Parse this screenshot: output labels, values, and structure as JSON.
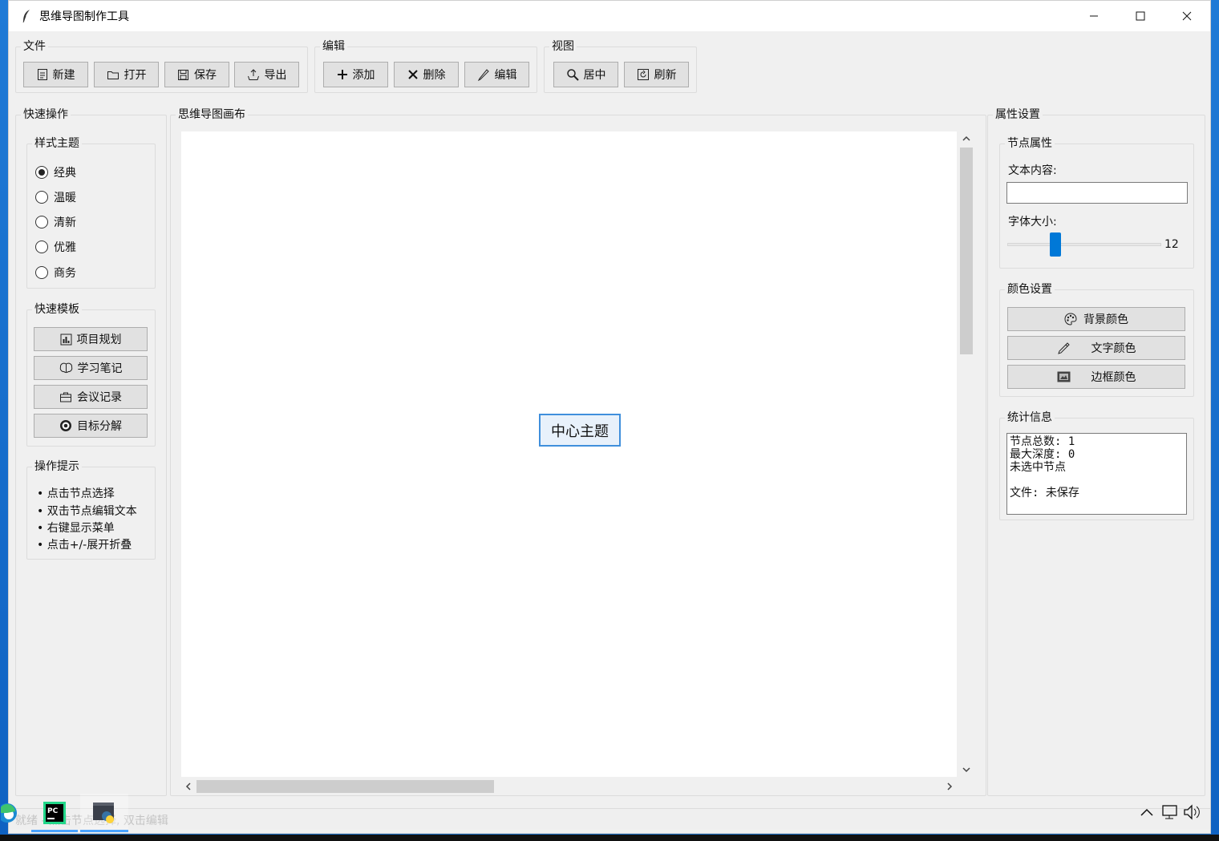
{
  "window": {
    "title": "思维导图制作工具"
  },
  "toolbar": {
    "file": {
      "label": "文件",
      "new": "新建",
      "open": "打开",
      "save": "保存",
      "export": "导出"
    },
    "edit": {
      "label": "编辑",
      "add": "添加",
      "delete": "删除",
      "edit": "编辑"
    },
    "view": {
      "label": "视图",
      "center": "居中",
      "refresh": "刷新"
    }
  },
  "quick_ops": {
    "label": "快速操作",
    "theme": {
      "label": "样式主题",
      "options": [
        "经典",
        "温暖",
        "清新",
        "优雅",
        "商务"
      ],
      "selected": "经典"
    },
    "templates": {
      "label": "快速模板",
      "items": [
        "项目规划",
        "学习笔记",
        "会议记录",
        "目标分解"
      ]
    },
    "tips": {
      "label": "操作提示",
      "items": [
        "• 点击节点选择",
        "• 双击节点编辑文本",
        "• 右键显示菜单",
        "• 点击+/-展开折叠"
      ]
    }
  },
  "canvas": {
    "label": "思维导图画布",
    "center_node": "中心主题"
  },
  "properties": {
    "label": "属性设置",
    "node": {
      "label": "节点属性",
      "text_label": "文本内容:",
      "text_value": "",
      "font_label": "字体大小:",
      "font_size": "12",
      "font_size_fraction": 0.3
    },
    "colors": {
      "label": "颜色设置",
      "bg": "背景颜色",
      "text": "文字颜色",
      "border": "边框颜色"
    },
    "stats": {
      "label": "统计信息",
      "text": "节点总数: 1\n最大深度: 0\n未选中节点\n\n文件: 未保存"
    }
  },
  "status": {
    "text": "就绪 - 点击节点选择, 双击编辑"
  },
  "colors": {
    "accent": "#0078d7",
    "node_border": "#3f8fdc",
    "node_bg": "#e8f1fb",
    "window_bg": "#f0f0f0"
  }
}
